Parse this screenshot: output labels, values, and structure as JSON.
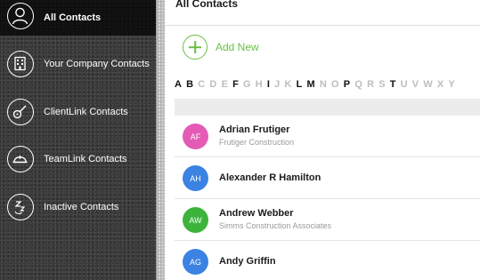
{
  "sidebar": {
    "items": [
      {
        "label": "All Contacts",
        "icon": "person-outline-icon",
        "active": true
      },
      {
        "label": "Your Company Contacts",
        "icon": "office-building-icon",
        "active": false
      },
      {
        "label": "ClientLink Contacts",
        "icon": "guitar-icon",
        "active": false
      },
      {
        "label": "TeamLink Contacts",
        "icon": "hard-hat-icon",
        "active": false
      },
      {
        "label": "Inactive Contacts",
        "icon": "sleep-zzz-icon",
        "active": false
      }
    ]
  },
  "main": {
    "title": "All Contacts",
    "add_new_label": "Add New",
    "alphabet": [
      {
        "letter": "A",
        "enabled": true
      },
      {
        "letter": "B",
        "enabled": true
      },
      {
        "letter": "C",
        "enabled": false
      },
      {
        "letter": "D",
        "enabled": false
      },
      {
        "letter": "E",
        "enabled": false
      },
      {
        "letter": "F",
        "enabled": true
      },
      {
        "letter": "G",
        "enabled": false
      },
      {
        "letter": "H",
        "enabled": false
      },
      {
        "letter": "I",
        "enabled": true
      },
      {
        "letter": "J",
        "enabled": false
      },
      {
        "letter": "K",
        "enabled": false
      },
      {
        "letter": "L",
        "enabled": true
      },
      {
        "letter": "M",
        "enabled": true
      },
      {
        "letter": "N",
        "enabled": false
      },
      {
        "letter": "O",
        "enabled": false
      },
      {
        "letter": "P",
        "enabled": true
      },
      {
        "letter": "Q",
        "enabled": false
      },
      {
        "letter": "R",
        "enabled": false
      },
      {
        "letter": "S",
        "enabled": false
      },
      {
        "letter": "T",
        "enabled": true
      },
      {
        "letter": "U",
        "enabled": false
      },
      {
        "letter": "V",
        "enabled": false
      },
      {
        "letter": "W",
        "enabled": false
      },
      {
        "letter": "X",
        "enabled": false
      },
      {
        "letter": "Y",
        "enabled": false
      }
    ],
    "contacts": [
      {
        "initials": "AF",
        "name": "Adrian Frutiger",
        "company": "Frutiger Construction",
        "color": "#e35bb4"
      },
      {
        "initials": "AH",
        "name": "Alexander R Hamilton",
        "company": "",
        "color": "#3b82e3"
      },
      {
        "initials": "AW",
        "name": "Andrew Webber",
        "company": "Simms Construction Associates",
        "color": "#3cb43c"
      },
      {
        "initials": "AG",
        "name": "Andy Griffin",
        "company": "",
        "color": "#3b82e3"
      }
    ]
  },
  "colors": {
    "accent_green": "#6abf45",
    "sidebar_active": "#111111",
    "text_dark": "#1b1b1b",
    "text_muted": "#9a9a9a"
  }
}
